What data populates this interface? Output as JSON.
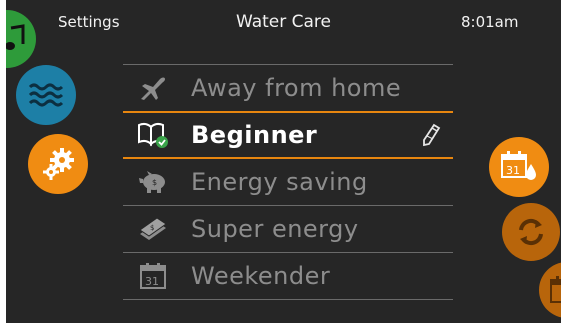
{
  "header": {
    "left": "Settings",
    "title": "Water Care",
    "time": "8:01am"
  },
  "menu": {
    "items": [
      {
        "label": "Away from home",
        "icon": "airplane-icon",
        "selected": false
      },
      {
        "label": "Beginner",
        "icon": "book-check-icon",
        "selected": true
      },
      {
        "label": "Energy saving",
        "icon": "piggy-bank-icon",
        "selected": false
      },
      {
        "label": "Super energy",
        "icon": "money-stack-icon",
        "selected": false
      },
      {
        "label": "Weekender",
        "icon": "calendar-31-icon",
        "selected": false
      }
    ],
    "calendar_day": "31"
  },
  "side_icons": {
    "left": [
      "music-icon",
      "water-waves-icon",
      "gear-icon"
    ],
    "right": [
      "calendar-water-icon",
      "refresh-icon",
      "calendar-partial-icon"
    ],
    "calendar_day": "31"
  },
  "colors": {
    "accent": "#e8860f",
    "background": "#262626",
    "water": "#1d7fa6",
    "music": "#2e9b3a",
    "inactive_text": "#8d8d8d"
  }
}
